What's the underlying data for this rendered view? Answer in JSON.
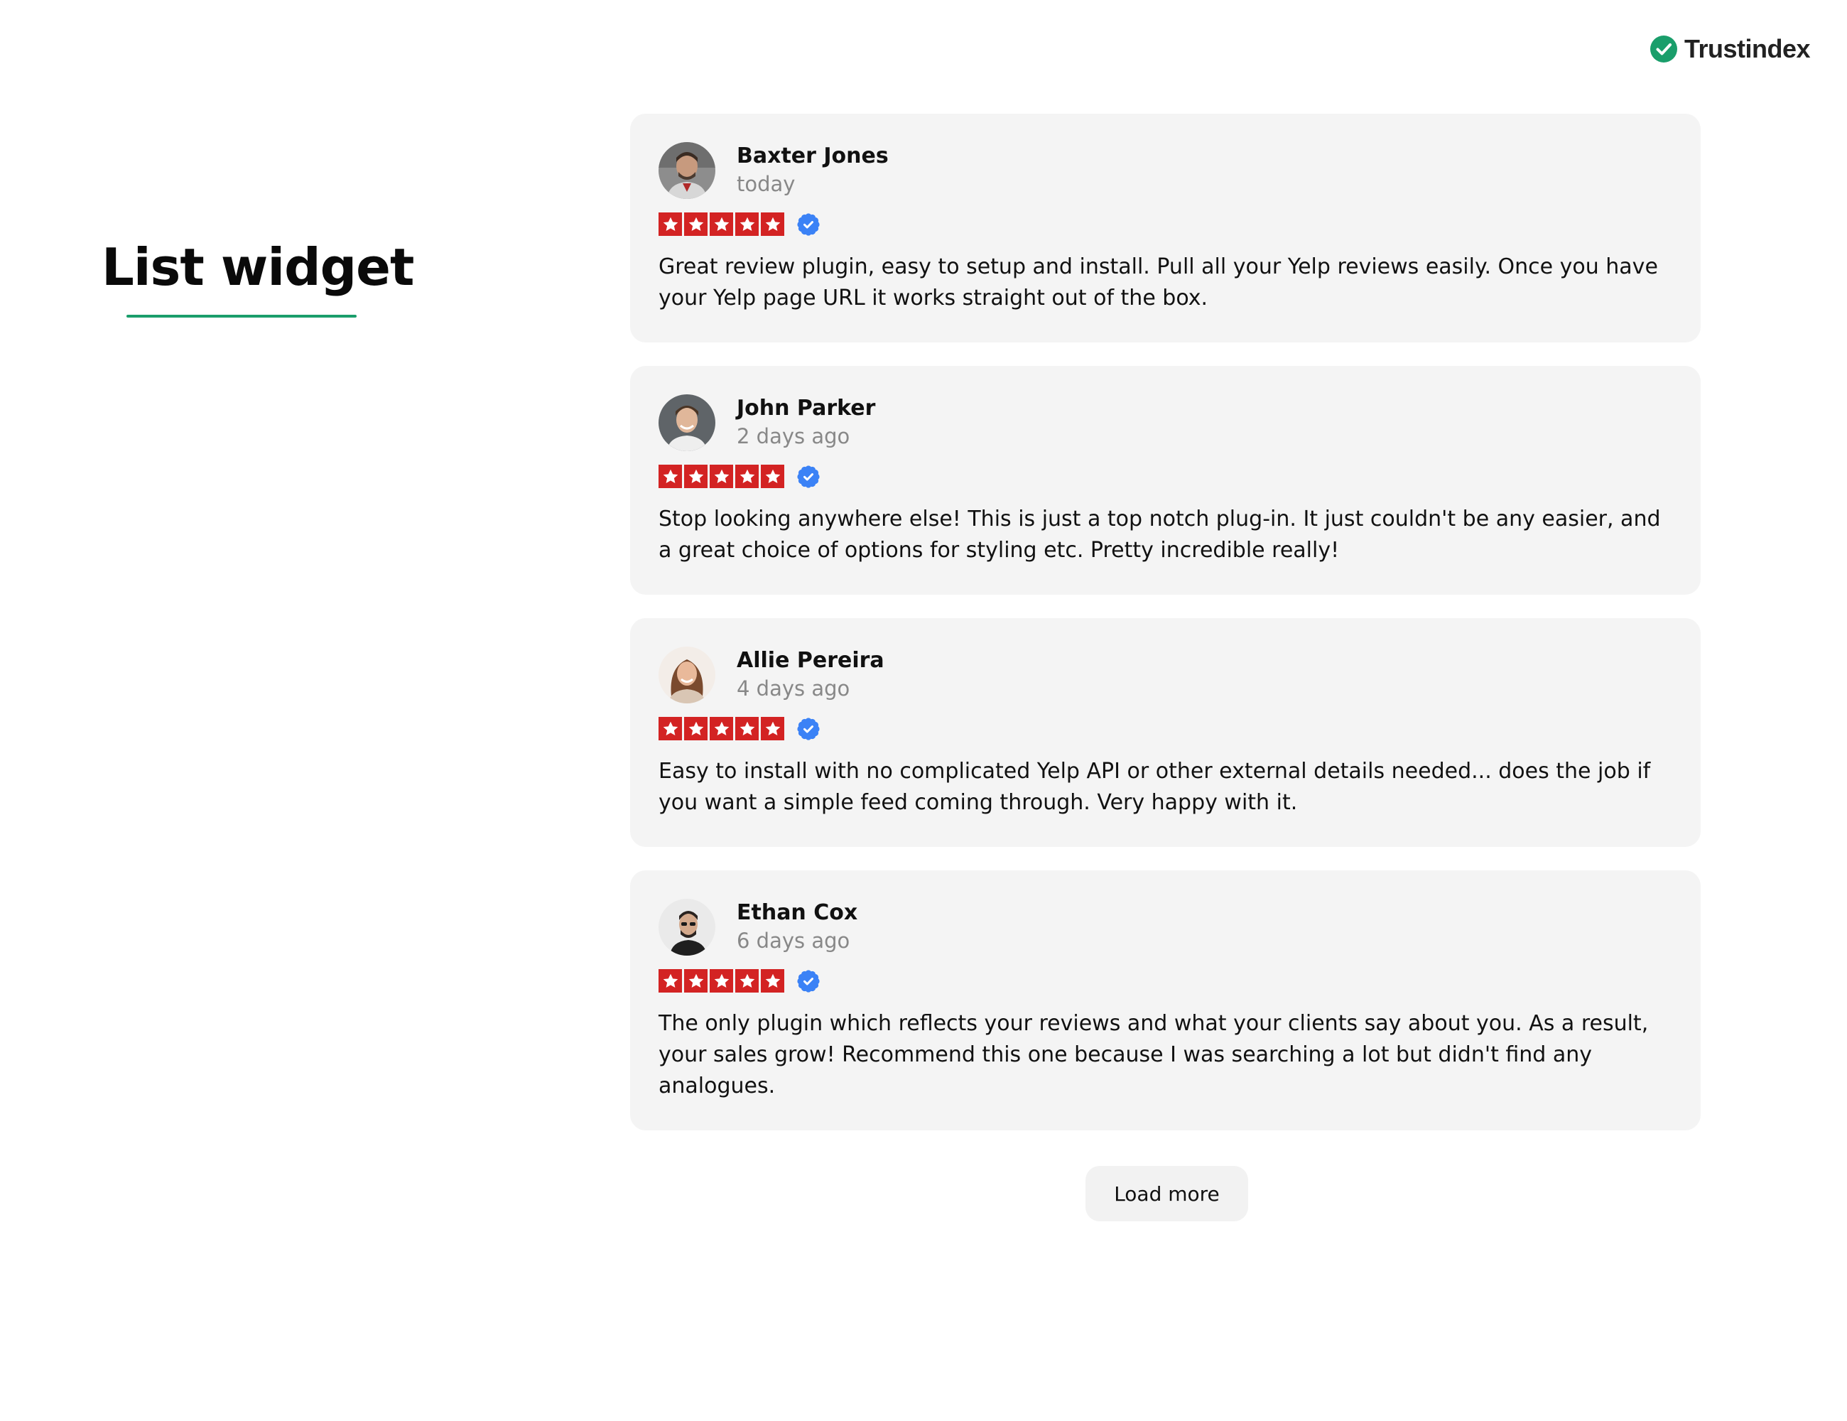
{
  "brand": {
    "name": "Trustindex",
    "icon": "check-circle-icon",
    "color": "#1a9e6b"
  },
  "heading": {
    "title": "List widget",
    "underline_color": "#1a9e6b"
  },
  "colors": {
    "star_bg": "#d32323",
    "verified": "#3b82f6"
  },
  "reviews": [
    {
      "name": "Baxter Jones",
      "date": "today",
      "rating": 5,
      "text": "Great review plugin, easy to setup and install. Pull all your Yelp reviews easily. Once you have your Yelp page URL it works straight out of the box."
    },
    {
      "name": "John Parker",
      "date": "2 days ago",
      "rating": 5,
      "text": "Stop looking anywhere else! This is just a top notch plug-in. It just couldn't be any easier, and a great choice of options for styling etc. Pretty incredible really!"
    },
    {
      "name": "Allie Pereira",
      "date": "4 days ago",
      "rating": 5,
      "text": "Easy to install with no complicated Yelp API or other external details needed... does the job if you want a simple feed coming through. Very happy with it."
    },
    {
      "name": "Ethan Cox",
      "date": "6 days ago",
      "rating": 5,
      "text": "The only plugin which reflects your reviews and what your clients say about you. As a result, your sales grow! Recommend this one because I was searching a lot but didn't find any analogues."
    }
  ],
  "load_more": {
    "label": "Load more"
  }
}
